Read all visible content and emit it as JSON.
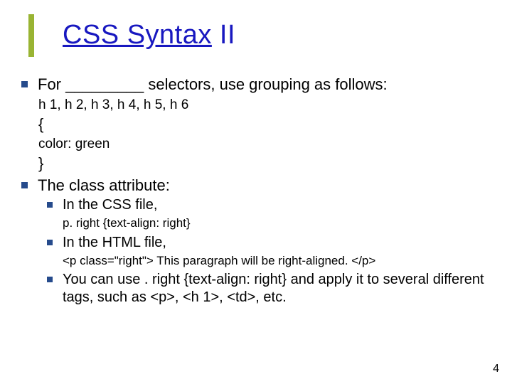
{
  "title": {
    "underlined": "CSS Syntax",
    "plain": " II"
  },
  "b1": {
    "text": "For _________ selectors, use grouping as follows:"
  },
  "code1": {
    "l1": "h 1, h 2, h 3, h 4, h 5, h 6",
    "l2": "{",
    "l3": "color: green",
    "l4": "}"
  },
  "b2": {
    "text": "The class attribute:"
  },
  "s1": {
    "text": "In the CSS file,",
    "code": "p. right {text-align: right}"
  },
  "s2": {
    "text": "In the HTML file,",
    "code": "<p class=\"right\"> This paragraph will be right-aligned. </p>"
  },
  "s3": {
    "text": "You can use . right {text-align: right} and apply it to several different tags, such as <p>, <h 1>, <td>, etc."
  },
  "page": "4"
}
